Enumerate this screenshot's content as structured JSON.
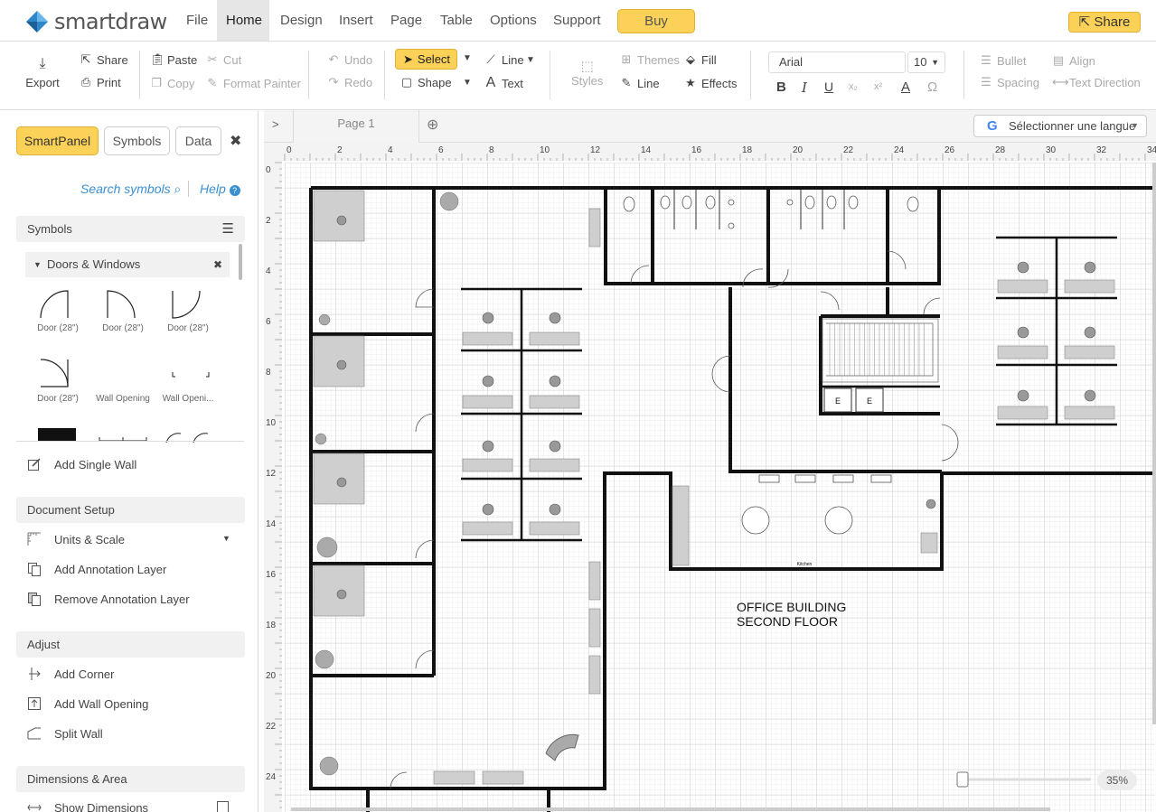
{
  "app": {
    "name": "smartdraw",
    "buy_label": "Buy",
    "share_label": "Share"
  },
  "menu": [
    "File",
    "Home",
    "Design",
    "Insert",
    "Page",
    "Table",
    "Options",
    "Support"
  ],
  "ribbon": {
    "export": "Export",
    "share": "Share",
    "print": "Print",
    "paste": "Paste",
    "cut": "Cut",
    "copy": "Copy",
    "format_painter": "Format Painter",
    "undo": "Undo",
    "redo": "Redo",
    "select": "Select",
    "shape": "Shape",
    "line": "Line",
    "text": "Text",
    "styles": "Styles",
    "themes": "Themes",
    "fill": "Fill",
    "line2": "Line",
    "effects": "Effects",
    "font_name": "Arial",
    "font_size": "10",
    "bullet": "Bullet",
    "align": "Align",
    "spacing": "Spacing",
    "text_direction": "Text Direction"
  },
  "panel": {
    "tabs": [
      "SmartPanel",
      "Symbols",
      "Data"
    ],
    "search": "Search symbols",
    "help": "Help",
    "symbols_head": "Symbols",
    "library": "Doors & Windows",
    "symbols": [
      "Door (28\")",
      "Door (28\")",
      "Door (28\")",
      "Door (28\")",
      "Wall Opening",
      "Wall Openi..."
    ],
    "add_single_wall": "Add Single Wall",
    "doc_setup": "Document Setup",
    "units_scale": "Units & Scale",
    "add_annot": "Add Annotation Layer",
    "remove_annot": "Remove Annotation Layer",
    "adjust": "Adjust",
    "add_corner": "Add Corner",
    "add_wall_opening": "Add Wall Opening",
    "split_wall": "Split Wall",
    "dimensions": "Dimensions & Area",
    "show_dimensions": "Show Dimensions"
  },
  "canvas": {
    "page_tab": "Page 1",
    "language": "Sélectionner une langue",
    "ruler_top": [
      "0",
      "2",
      "4",
      "6",
      "8",
      "10",
      "12",
      "14",
      "16",
      "18",
      "20",
      "22",
      "24",
      "26",
      "28",
      "30",
      "32",
      "34"
    ],
    "ruler_left": [
      "0",
      "2",
      "4",
      "6",
      "8",
      "10",
      "12",
      "14",
      "16",
      "18",
      "20",
      "22",
      "24"
    ],
    "title_line1": "OFFICE BUILDING",
    "title_line2": "SECOND FLOOR",
    "kitchen_label": "Kitchen",
    "elevator_label": "E",
    "zoom": "35%"
  },
  "colors": {
    "accent": "#fbd257",
    "link": "#3a8fd0",
    "wall": "#111111"
  }
}
